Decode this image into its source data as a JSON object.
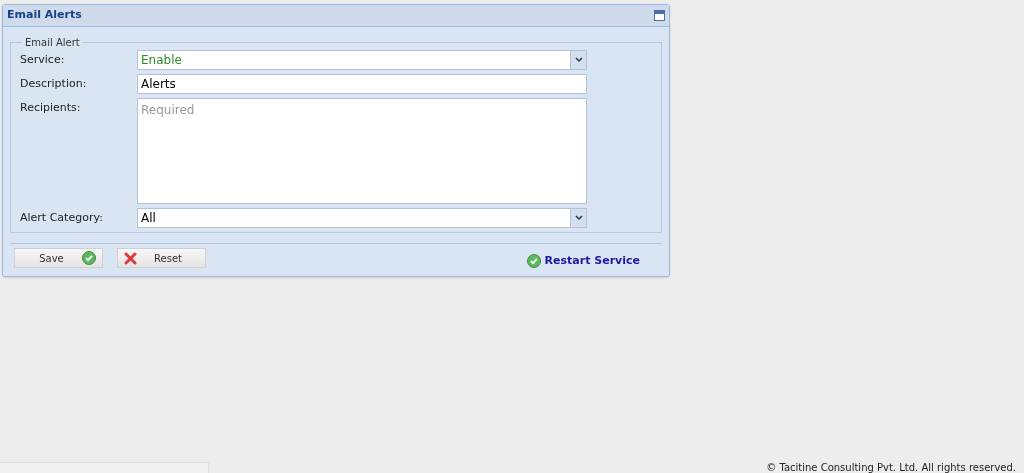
{
  "panel": {
    "title": "Email Alerts"
  },
  "fieldset": {
    "legend": "Email Alert",
    "fields": [
      {
        "kind": "status-select",
        "label": "Service:",
        "value": "Enable"
      },
      {
        "kind": "text",
        "label": "Description:",
        "value": "Alerts"
      },
      {
        "kind": "textarea",
        "label": "Recipients:",
        "placeholder": "Required"
      },
      {
        "kind": "select",
        "label": "Alert Category:",
        "value": "All"
      }
    ]
  },
  "buttons": [
    {
      "kind": "save",
      "label": "Save"
    },
    {
      "kind": "reset",
      "label": "Reset"
    }
  ],
  "restart_link": "Restart Service",
  "footer": "© Tacitine Consulting Pvt. Ltd. All rights reserved."
}
